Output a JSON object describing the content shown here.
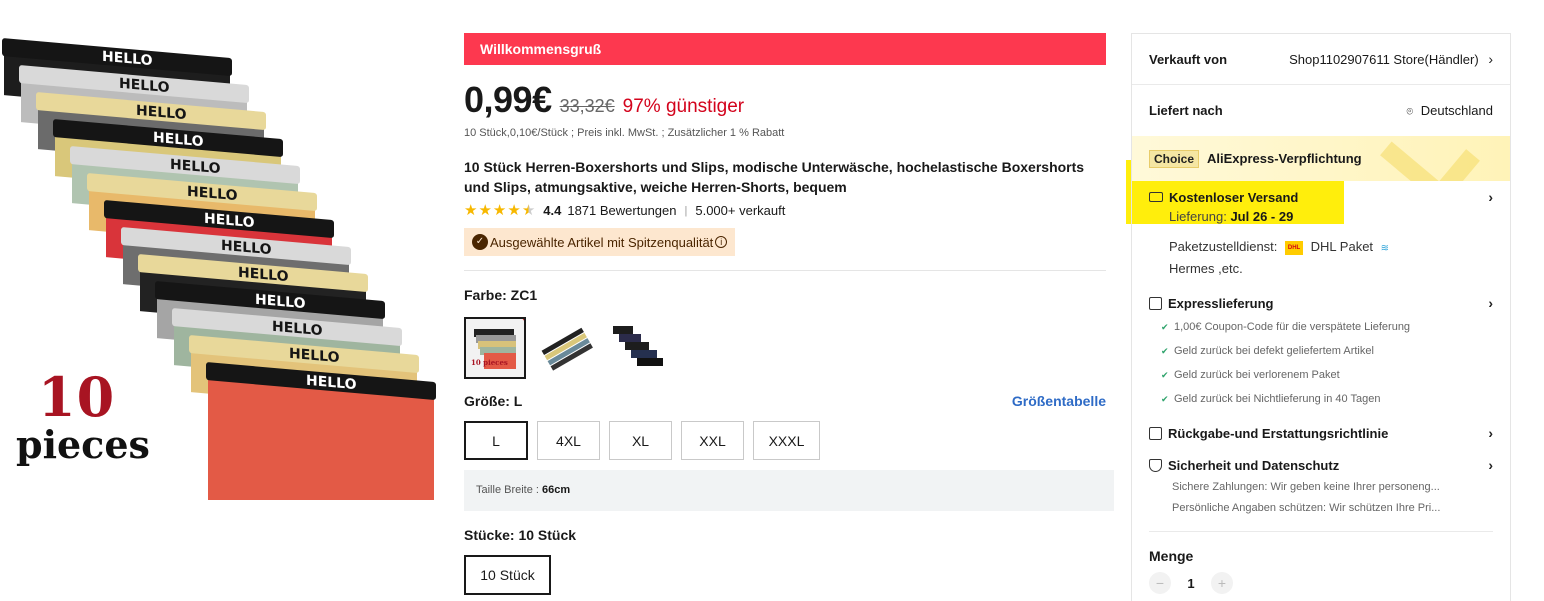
{
  "gallery": {
    "pieces_number": "10",
    "pieces_word": "pieces",
    "waistband_text": "HELLO",
    "colors": [
      "#1d1d1d",
      "#bcbcbc",
      "#6b6b6b",
      "#d9c77a",
      "#b0c4b0",
      "#e8b96a",
      "#d9343a",
      "#6e6e6e",
      "#222222",
      "#a5a5a5",
      "#9fb59f",
      "#e3c37a",
      "#e35a46"
    ]
  },
  "promo": {
    "banner": "Willkommensgruß"
  },
  "price": {
    "current": "0,99€",
    "original": "33,32€",
    "discount": "97% günstiger",
    "note": "10 Stück,0,10€/Stück ; Preis inkl. MwSt. ; Zusätzlicher 1 % Rabatt"
  },
  "product": {
    "title": "10 Stück Herren-Boxershorts und Slips, modische Unterwäsche, hochelastische Boxershorts und Slips, atmungsaktive, weiche Herren-Shorts, bequem",
    "rating": "4.4",
    "rating_value": 4.4,
    "reviews": "1871 Bewertungen",
    "sold": "5.000+ verkauft",
    "quality_badge": "Ausgewählte Artikel mit Spitzenqualität"
  },
  "color": {
    "label": "Farbe: ZC1",
    "thumb_pieces": "10 pieces"
  },
  "size": {
    "label": "Größe: L",
    "chart_link": "Größentabelle",
    "options": [
      "L",
      "4XL",
      "XL",
      "XXL",
      "XXXL"
    ],
    "selected": "L",
    "info_label": "Taille Breite :",
    "info_value": "66cm"
  },
  "pieces": {
    "label": "Stücke: 10 Stück",
    "option": "10 Stück"
  },
  "side": {
    "seller_label": "Verkauft von",
    "seller_name": "Shop1102907611 Store(Händler)",
    "ship_to_label": "Liefert nach",
    "ship_to_value": "Deutschland",
    "choice_tag": "Choice",
    "choice_title": "AliExpress-Verpflichtung",
    "free_shipping": "Kostenloser Versand",
    "delivery_label": "Lieferung:",
    "delivery_dates": "Jul 26 - 29",
    "carrier_label": "Paketzustelldienst:",
    "carrier_name": "DHL Paket",
    "carrier_more": "Hermes ,etc.",
    "express_title": "Expresslieferung",
    "express_items": [
      "1,00€ Coupon-Code für die verspätete Lieferung",
      "Geld zurück bei defekt geliefertem Artikel",
      "Geld zurück bei verlorenem Paket",
      "Geld zurück bei Nichtlieferung in 40 Tagen"
    ],
    "return_title": "Rückgabe-und Erstattungsrichtlinie",
    "security_title": "Sicherheit und Datenschutz",
    "security_items": [
      "Sichere Zahlungen: Wir geben keine Ihrer personeng...",
      "Persönliche Angaben schützen: Wir schützen Ihre Pri..."
    ],
    "qty_label": "Menge",
    "qty_value": "1",
    "qty_minus": "−",
    "qty_plus": "+"
  }
}
